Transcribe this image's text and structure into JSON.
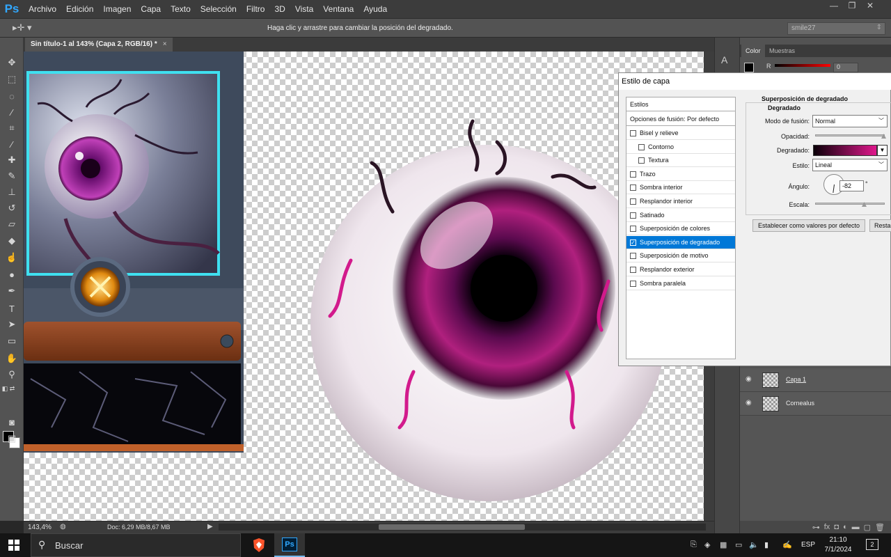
{
  "app": {
    "logo": "Ps"
  },
  "menubar": {
    "items": [
      "Archivo",
      "Edición",
      "Imagen",
      "Capa",
      "Texto",
      "Selección",
      "Filtro",
      "3D",
      "Vista",
      "Ventana",
      "Ayuda"
    ]
  },
  "window_controls": {
    "minimize": "—",
    "restore": "❐",
    "close": "✕"
  },
  "options_bar": {
    "hint": "Haga clic y arrastre para cambiar la posición del degradado.",
    "workspace": "smile27"
  },
  "document": {
    "tab_title": "Sin título-1 al 143% (Capa 2, RGB/16) *",
    "tab_close": "×"
  },
  "status": {
    "zoom": "143,4%",
    "doc_size": "Doc: 6,29 MB/8,67 MB"
  },
  "panels": {
    "tabs": [
      "Color",
      "Muestras"
    ],
    "color_channel": "R",
    "color_value": "0"
  },
  "layers": [
    {
      "name": "Capa 1",
      "visible": true
    },
    {
      "name": "Cornealus",
      "visible": true
    }
  ],
  "dialog": {
    "title": "Estilo de capa",
    "styles_header": "Estilos",
    "blend_options": "Opciones de fusión: Por defecto",
    "styles": [
      {
        "label": "Bisel y relieve",
        "checked": false,
        "sub": false,
        "selected": false
      },
      {
        "label": "Contorno",
        "checked": false,
        "sub": true,
        "selected": false
      },
      {
        "label": "Textura",
        "checked": false,
        "sub": true,
        "selected": false
      },
      {
        "label": "Trazo",
        "checked": false,
        "sub": false,
        "selected": false
      },
      {
        "label": "Sombra interior",
        "checked": false,
        "sub": false,
        "selected": false
      },
      {
        "label": "Resplandor interior",
        "checked": false,
        "sub": false,
        "selected": false
      },
      {
        "label": "Satinado",
        "checked": false,
        "sub": false,
        "selected": false
      },
      {
        "label": "Superposición de colores",
        "checked": false,
        "sub": false,
        "selected": false
      },
      {
        "label": "Superposición de degradado",
        "checked": true,
        "sub": false,
        "selected": true
      },
      {
        "label": "Superposición de motivo",
        "checked": false,
        "sub": false,
        "selected": false
      },
      {
        "label": "Resplandor exterior",
        "checked": false,
        "sub": false,
        "selected": false
      },
      {
        "label": "Sombra paralela",
        "checked": false,
        "sub": false,
        "selected": false
      }
    ],
    "section_title": "Superposición de degradado",
    "group_title": "Degradado",
    "blend_mode_label": "Modo de fusión:",
    "blend_mode_value": "Normal",
    "opacity_label": "Opacidad:",
    "opacity_value": 1.0,
    "gradient_label": "Degradado:",
    "gradient_colors": [
      "#0a0008",
      "#e0188c"
    ],
    "style_label": "Estilo:",
    "style_value": "Lineal",
    "angle_label": "Ángulo:",
    "angle_value": "-82",
    "angle_unit": "°",
    "scale_label": "Escala:",
    "scale_value": 0.5,
    "btn_default": "Establecer como valores por defecto",
    "btn_reset": "Restaurar valores por defecto"
  },
  "taskbar": {
    "search_placeholder": "Buscar",
    "apps": [
      "brave-browser",
      "photoshop"
    ],
    "lang": "ESP",
    "time": "21:10",
    "date": "7/1/2024",
    "notifications": "2"
  }
}
